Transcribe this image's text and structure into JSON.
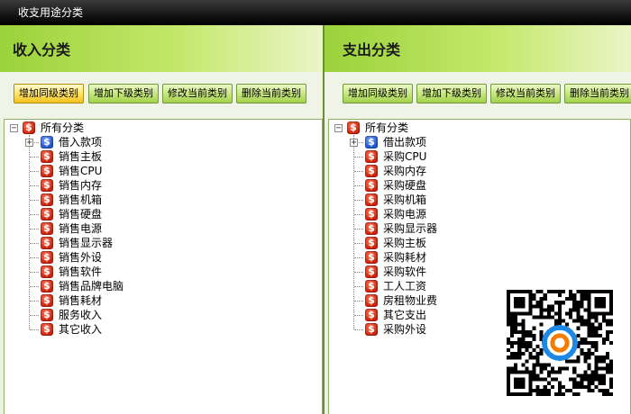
{
  "window": {
    "title": "收支用途分类"
  },
  "income": {
    "title": "收入分类",
    "buttons": [
      "增加同级类别",
      "增加下级类别",
      "修改当前类别",
      "删除当前类别"
    ],
    "root": "所有分类",
    "children": [
      "借入款项",
      "销售主板",
      "销售CPU",
      "销售内存",
      "销售机箱",
      "销售硬盘",
      "销售电源",
      "销售显示器",
      "销售外设",
      "销售软件",
      "销售品牌电脑",
      "销售耗材",
      "服务收入",
      "其它收入"
    ]
  },
  "expense": {
    "title": "支出分类",
    "buttons": [
      "增加同级类别",
      "增加下级类别",
      "修改当前类别",
      "删除当前类别"
    ],
    "root": "所有分类",
    "children": [
      "借出款项",
      "采购CPU",
      "采购内存",
      "采购硬盘",
      "采购机箱",
      "采购电源",
      "采购显示器",
      "采购主板",
      "采购耗材",
      "采购软件",
      "工人工资",
      "房租物业费",
      "其它支出",
      "采购外设"
    ]
  },
  "colors": {
    "header": "#9bd23b",
    "button": "#c6e77f",
    "active_button": "#ffe36a",
    "icon_red": "#c81f0a",
    "icon_blue": "#1e4fc9"
  }
}
